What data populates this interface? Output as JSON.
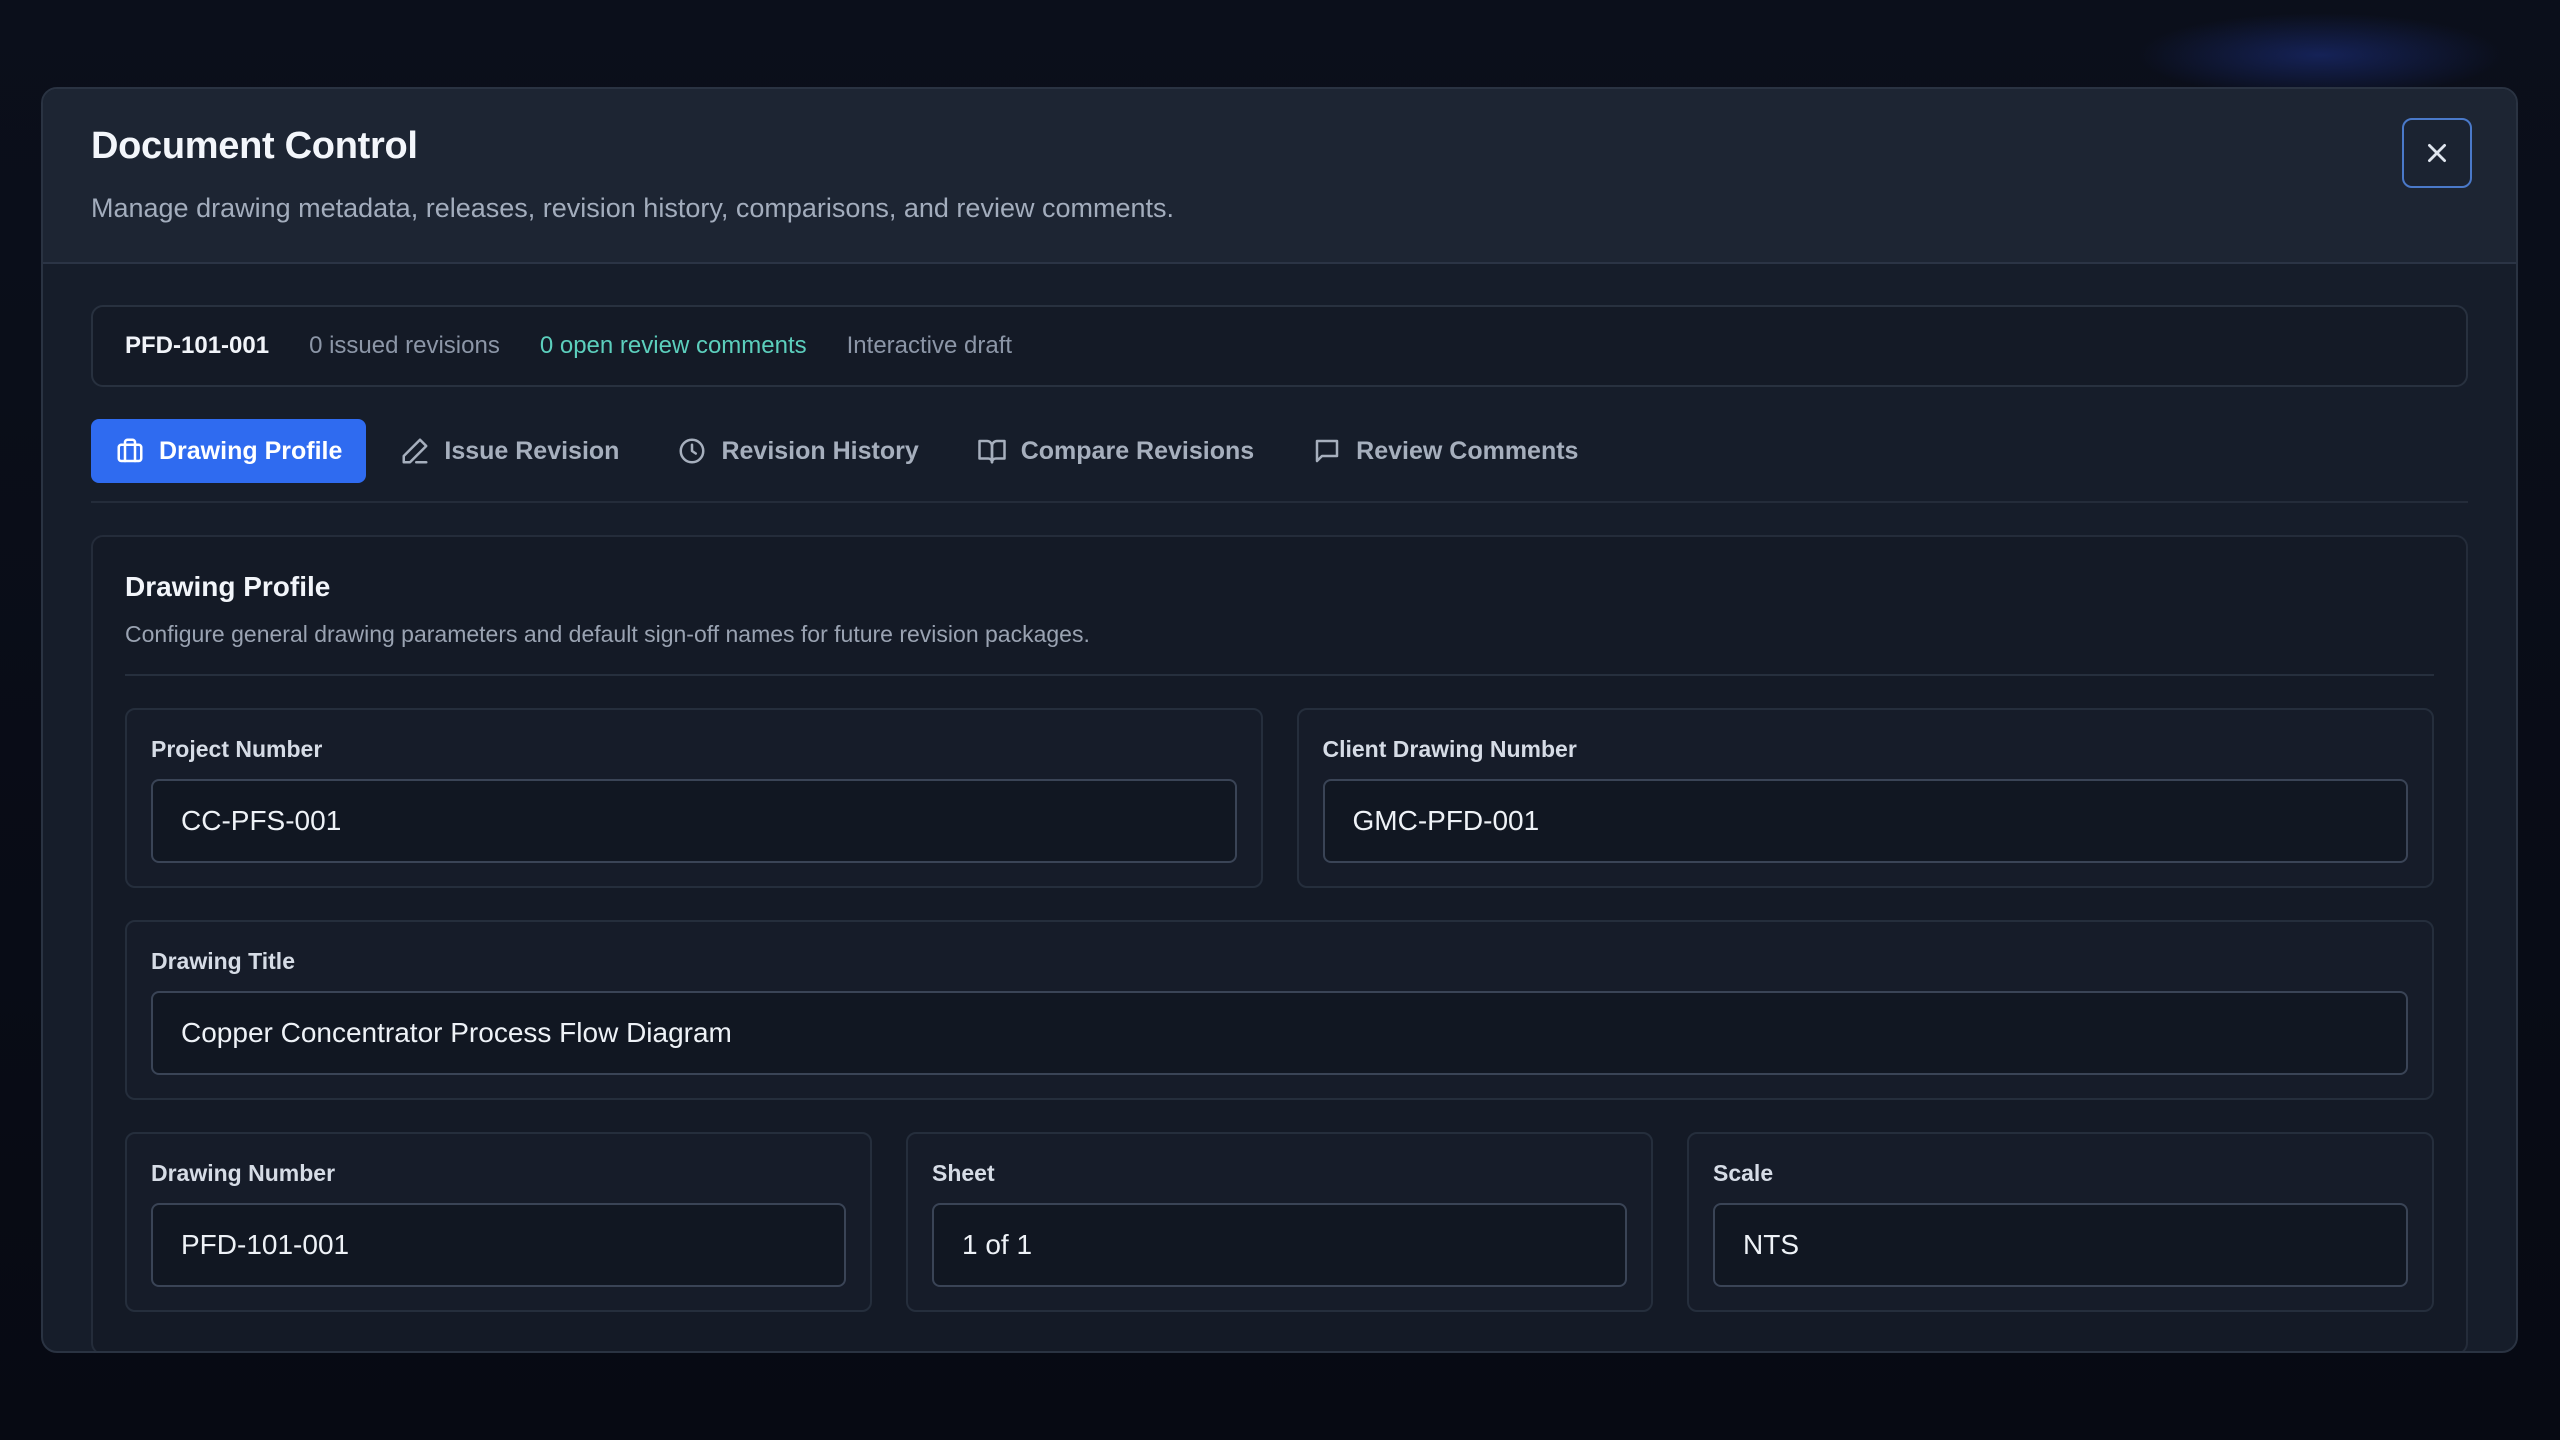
{
  "modal": {
    "title": "Document Control",
    "description": "Manage drawing metadata, releases, revision history, comparisons, and review comments."
  },
  "info_bar": {
    "drawing_id": "PFD-101-001",
    "issued_revisions": "0 issued revisions",
    "open_comments": "0 open review comments",
    "status": "Interactive draft"
  },
  "tabs": [
    {
      "label": "Drawing Profile",
      "icon": "briefcase-icon",
      "active": true
    },
    {
      "label": "Issue Revision",
      "icon": "pencil-icon",
      "active": false
    },
    {
      "label": "Revision History",
      "icon": "clock-icon",
      "active": false
    },
    {
      "label": "Compare Revisions",
      "icon": "book-open-icon",
      "active": false
    },
    {
      "label": "Review Comments",
      "icon": "message-icon",
      "active": false
    }
  ],
  "panel": {
    "title": "Drawing Profile",
    "description": "Configure general drawing parameters and default sign-off names for future revision packages."
  },
  "fields": {
    "project_number": {
      "label": "Project Number",
      "value": "CC-PFS-001"
    },
    "client_drawing_number": {
      "label": "Client Drawing Number",
      "value": "GMC-PFD-001"
    },
    "drawing_title": {
      "label": "Drawing Title",
      "value": "Copper Concentrator Process Flow Diagram"
    },
    "drawing_number": {
      "label": "Drawing Number",
      "value": "PFD-101-001"
    },
    "sheet": {
      "label": "Sheet",
      "value": "1 of 1"
    },
    "scale": {
      "label": "Scale",
      "value": "NTS"
    }
  },
  "colors": {
    "accent": "#2f6bf0",
    "accent_text": "#5ccfbd",
    "modal_bg": "#161d2a",
    "page_bg": "#080b14"
  }
}
